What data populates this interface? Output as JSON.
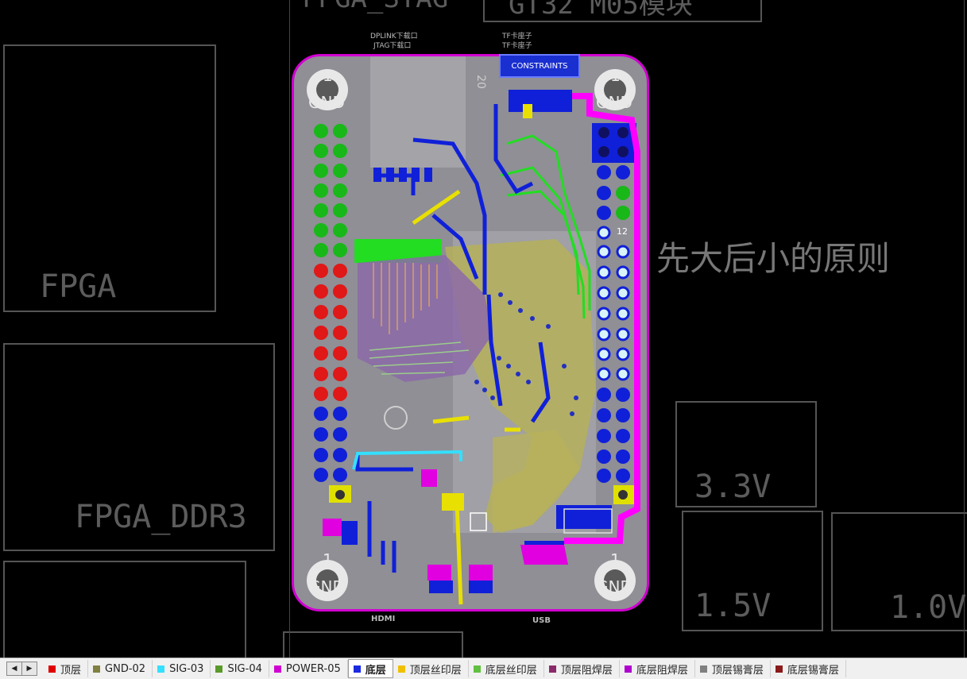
{
  "canvas": {
    "labels": {
      "top_left_partial": "FPGA_STAG",
      "top_center_partial": "GT32 M05模块",
      "fpga": "FPGA",
      "fpga_ddr3": "FPGA_DDR3",
      "v33": "3.3V",
      "v15": "1.5V",
      "v10": "1.0V",
      "rule": "先大后小的原则"
    },
    "board": {
      "gnd_labels": [
        "GND",
        "GND",
        "GND",
        "GND"
      ],
      "hole_number": "1",
      "header_pin_number": "12",
      "top_left_silk_1": "DPLINK下载口",
      "top_left_silk_2": "JTAG下载口",
      "top_right_silk_1": "TF卡座子",
      "top_right_silk_2": "TF卡座子",
      "version_text": "20",
      "constraints_label": "CONSTRAINTS",
      "bottom_left": "HDMI",
      "bottom_right": "USB"
    }
  },
  "layer_tabs": [
    {
      "label": "顶层",
      "color": "#e00000",
      "active": false
    },
    {
      "label": "GND-02",
      "color": "#808040",
      "active": false
    },
    {
      "label": "SIG-03",
      "color": "#33e0ff",
      "active": false
    },
    {
      "label": "SIG-04",
      "color": "#5a9a2a",
      "active": false
    },
    {
      "label": "POWER-05",
      "color": "#d000d0",
      "active": false
    },
    {
      "label": "底层",
      "color": "#1a2ae0",
      "active": true
    },
    {
      "label": "顶层丝印层",
      "color": "#f0c000",
      "active": false
    },
    {
      "label": "底层丝印层",
      "color": "#60c040",
      "active": false
    },
    {
      "label": "顶层阻焊层",
      "color": "#8a2a6a",
      "active": false
    },
    {
      "label": "底层阻焊层",
      "color": "#b000d0",
      "active": false
    },
    {
      "label": "顶层锡膏层",
      "color": "#808080",
      "active": false
    },
    {
      "label": "底层锡膏层",
      "color": "#8a1a1a",
      "active": false
    }
  ],
  "nav": {
    "prev": "◀",
    "next": "▶"
  }
}
